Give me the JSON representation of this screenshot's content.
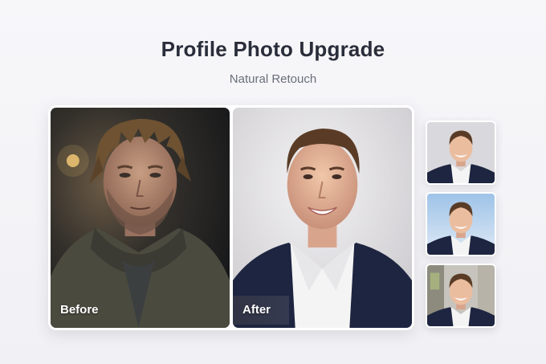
{
  "header": {
    "title": "Profile Photo Upgrade",
    "subtitle": "Natural Retouch"
  },
  "comparison": {
    "before_label": "Before",
    "after_label": "After"
  },
  "thumbnails": [
    {
      "background": "studio-grey"
    },
    {
      "background": "sky-blue"
    },
    {
      "background": "office-window"
    }
  ],
  "colors": {
    "title": "#2a2d3a",
    "subtitle": "#6a6e7a",
    "suit": "#1d2540",
    "shirt": "#f4f4f4"
  }
}
